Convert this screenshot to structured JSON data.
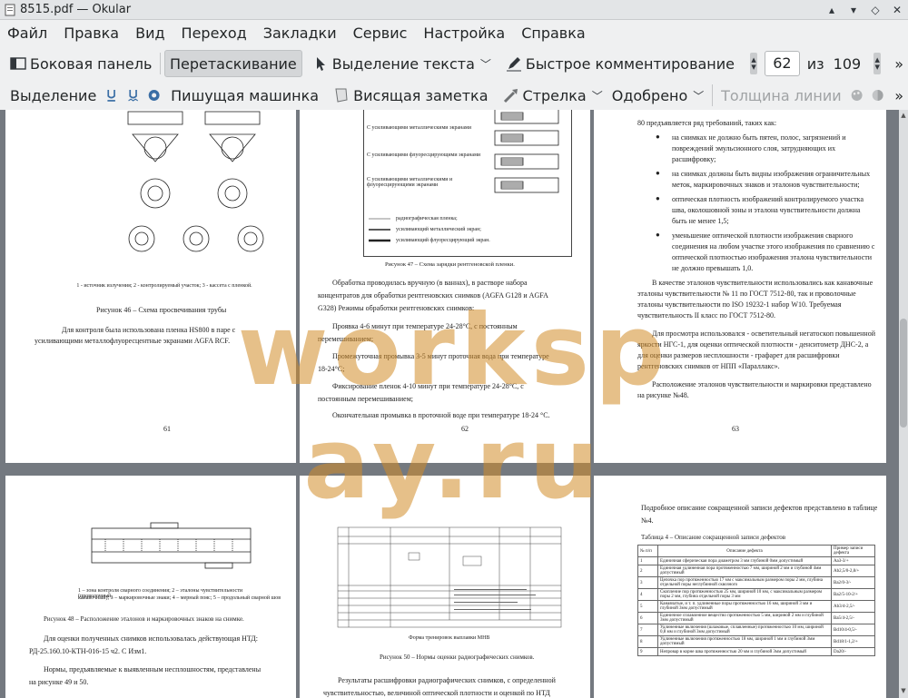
{
  "window": {
    "title": "8515.pdf — Okular"
  },
  "menu": [
    "Файл",
    "Правка",
    "Вид",
    "Переход",
    "Закладки",
    "Сервис",
    "Настройка",
    "Справка"
  ],
  "toolbar1": {
    "sidebar": "Боковая панель",
    "drag": "Перетаскивание",
    "text_select": "Выделение текста",
    "quick_annot": "Быстрое комментирование",
    "page_current": "62",
    "page_of": "из",
    "page_total": "109"
  },
  "toolbar2": {
    "highlight": "Выделение",
    "typewriter": "Пишущая машинка",
    "note": "Висящая заметка",
    "arrow": "Стрелка",
    "approved": "Одобрено",
    "line_width": "Толщина линии"
  },
  "watermark": "worksp ay.ru",
  "pages": {
    "p61": {
      "caption_small": "1 - источник излучения; 2 - контролируемый участок; 3 - кассета с пленкой.",
      "caption": "Рисунок 46 – Схема просвечивания трубы",
      "text1": "Для контроля была использована пленка HS800 в паре с",
      "text2": "усиливающими металлофлуоресцентные экранами AGFA RCF.",
      "num": "61"
    },
    "p62": {
      "legend1": "С усиливающими металлическими экранами",
      "legend2": "С усиливающими флуоресцирующими экранами",
      "legend3": "С усиливающими металлическими и флуоресцирующими экранами",
      "legend4": "радиографическая пленка;",
      "legend5": "усиливающий металлический экран;",
      "legend6": "усиливающий флуоресцирующий экран.",
      "caption": "Рисунок 47 – Схема зарядки рентгеновской пленки.",
      "lines": [
        "Обработка проводилась вручную (в ваннах), в растворе набора",
        "концентратов для обработки рентгеновских снимков (AGFA G128 и AGFA",
        "G328) Режимы обработки рентгеновских снимков:",
        "Проявка 4-6 минут при температуре 24-28°C, с постоянным",
        "перемешиванием;",
        "Промежуточная промывка 3-5 минут проточная вода при температуре",
        "18-24°C;",
        "Фиксирование пленок 4-10 минут при температуре 24-28°C, с",
        "постоянным перемешиванием;",
        "Окончательная промывка в проточной воде при температуре 18-24 °C."
      ],
      "num": "62"
    },
    "p63": {
      "lines": [
        "80 предъявляется ряд требований, таких как:",
        "на снимках не должно быть пятен, полос, загрязнений и",
        "повреждений эмульсионного слоя, затрудняющих их",
        "расшифровку;",
        "на снимках должны быть видны изображения ограничительных",
        "меток, маркировочных знаков и эталонов чувствительности;",
        "оптическая плотность изображений контролируемого участка",
        "шва, околошовной зоны и эталона чувствительности должна",
        "быть не менее 1,5;",
        "уменьшение оптической плотности изображения сварного",
        "соединения на любом участке этого изображения по сравнению с",
        "оптической плотностью изображения эталона чувствительности",
        "не должно превышать 1,0.",
        "В качестве эталонов чувствительности использовались как канавочные",
        "эталоны чувствительности № 11 по ГОСТ 7512-80, так и проволочные",
        "эталоны чувствительности по ISO 19232-1 набор W10. Требуемая",
        "чувствительность II класс по ГОСТ 7512-80.",
        "Для просмотра использовался - осветительный негатоскоп повышенной",
        "яркости НГС-1, для оценки оптической плотности - денситометр ДНС-2, а",
        "для оценки размеров несплошности - графарет для расшифровки",
        "рентгеновских снимков от НПП «Параллакс».",
        "Расположение эталонов чувствительности и маркировки представлено",
        "на рисунке №48."
      ],
      "num": "63"
    },
    "p64": {
      "caption_small1": "1 – зона контроля сварного соединения; 2 – эталоны чувствительности (проволочный,",
      "caption_small2": "канавочный); 3 – маркировочные знаки; 4 – мерный пояс; 5 – продольный сварной шов",
      "caption": "Рисунок 48 – Расположение эталонов и маркировочных знаков на снимке.",
      "lines": [
        "Для оценки полученных снимков использовалась действующая НТД:",
        "РД-25.160.10-КТН-016-15 ч2. С Изм1.",
        "Нормы, предъявляемые к выявленным несплошностям, представлены",
        "на рисунке 49 и 50."
      ]
    },
    "p65": {
      "small": "Форма тренировок выплавки МНВ",
      "caption": "Рисунок 50 – Нормы оценки радиографических снимков.",
      "lines": [
        "Результаты расшифровки радиографических снимков, с определенной",
        "чувствительностью, величиной оптической плотности и оценкой по НТД"
      ]
    },
    "p66": {
      "lines": [
        "Подробное описание сокращенной записи дефектов представлено в таблице",
        "№4."
      ],
      "table_caption": "Таблица 4 – Описание сокращенной записи дефектов",
      "head": [
        "№ п/п",
        "Описание дефекта",
        "Пример записи дефекта"
      ],
      "rows": [
        [
          "1",
          "Единичная сферическая пора диаметром 3 мм глубиной 0мм допустимый",
          "Аа3-3/+"
        ],
        [
          "2",
          "Единичная удлиненная пора протяженностью 7 мм, шириной 2 мм и глубиной 4мм допустимый",
          "Ab2,5/0-2,8/+"
        ],
        [
          "3",
          "Цепочка пор протяженностью 17 мм с максимальным размером поры 2 мм, глубина отдельной поры неглубинной сквозного",
          "Ba2/0-3/-"
        ],
        [
          "4",
          "Скопление пор протяженностью 25 мм, шириной 10 мм, с максимальным размером поры 2 мм, глубина отдельной поры 3 мм",
          "Ba2/5-10-2/+"
        ],
        [
          "5",
          "Канавчатые, и т. п. удлиненные поры протяженностью 16 мм, шириной 3 мм и глубиной 3мм допустимый",
          "Ab3/4-2,5/-"
        ],
        [
          "6",
          "Единичное сплавленное вещество протяженностью 5 мм, шириной 2 мм и глубиной 3мм допустимый",
          "Ba5/4-2,5/-"
        ],
        [
          "7",
          "Удлиненные включения (шлаковые, сплавленные) протяженностью 10 мм, шириной 0,8 мм и глубиной 3мм допустимый",
          "Bd10/4-0,5/-"
        ],
        [
          "8",
          "Удлиненные включения протяженностью 18 мм, шириной 1 мм и глубиной 3мм допустимый",
          "Bd18/1-1,2/+"
        ],
        [
          "9",
          "Непровар в корне шва протяженностью 20 мм и глубиной 3мм допустимый",
          "Da20/-"
        ]
      ]
    }
  }
}
